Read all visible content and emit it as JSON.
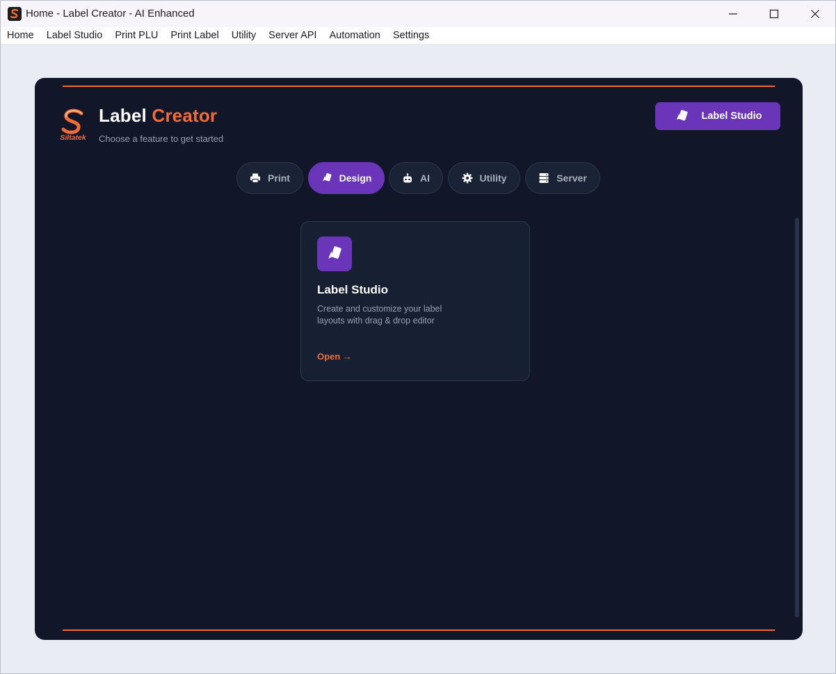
{
  "window": {
    "title": "Home - Label Creator - AI Enhanced",
    "controls": [
      "minimize-icon",
      "maximize-icon",
      "close-icon"
    ]
  },
  "menu": {
    "items": [
      "Home",
      "Label Studio",
      "Print PLU",
      "Print Label",
      "Utility",
      "Server API",
      "Automation",
      "Settings"
    ]
  },
  "header": {
    "logo_text": "Siltatek",
    "title_main": "Label",
    "title_accent": "Creator",
    "subtitle": "Choose a feature to get started",
    "action_button": {
      "label": "Label Studio",
      "icon": "cards-icon"
    }
  },
  "tabs": [
    {
      "label": "Print",
      "icon": "printer-icon",
      "active": false
    },
    {
      "label": "Design",
      "icon": "cards-icon",
      "active": true
    },
    {
      "label": "AI",
      "icon": "robot-icon",
      "active": false
    },
    {
      "label": "Utility",
      "icon": "gear-icon",
      "active": false
    },
    {
      "label": "Server",
      "icon": "server-icon",
      "active": false
    }
  ],
  "cards": [
    {
      "title": "Label Studio",
      "description": "Create and customize your label layouts with drag & drop editor",
      "link": "Open →",
      "icon": "cards-icon"
    }
  ],
  "colors": {
    "accent_orange": "#f26b38",
    "accent_purple": "#6a35b8",
    "panel_bg": "#111728",
    "card_bg": "#172033"
  }
}
